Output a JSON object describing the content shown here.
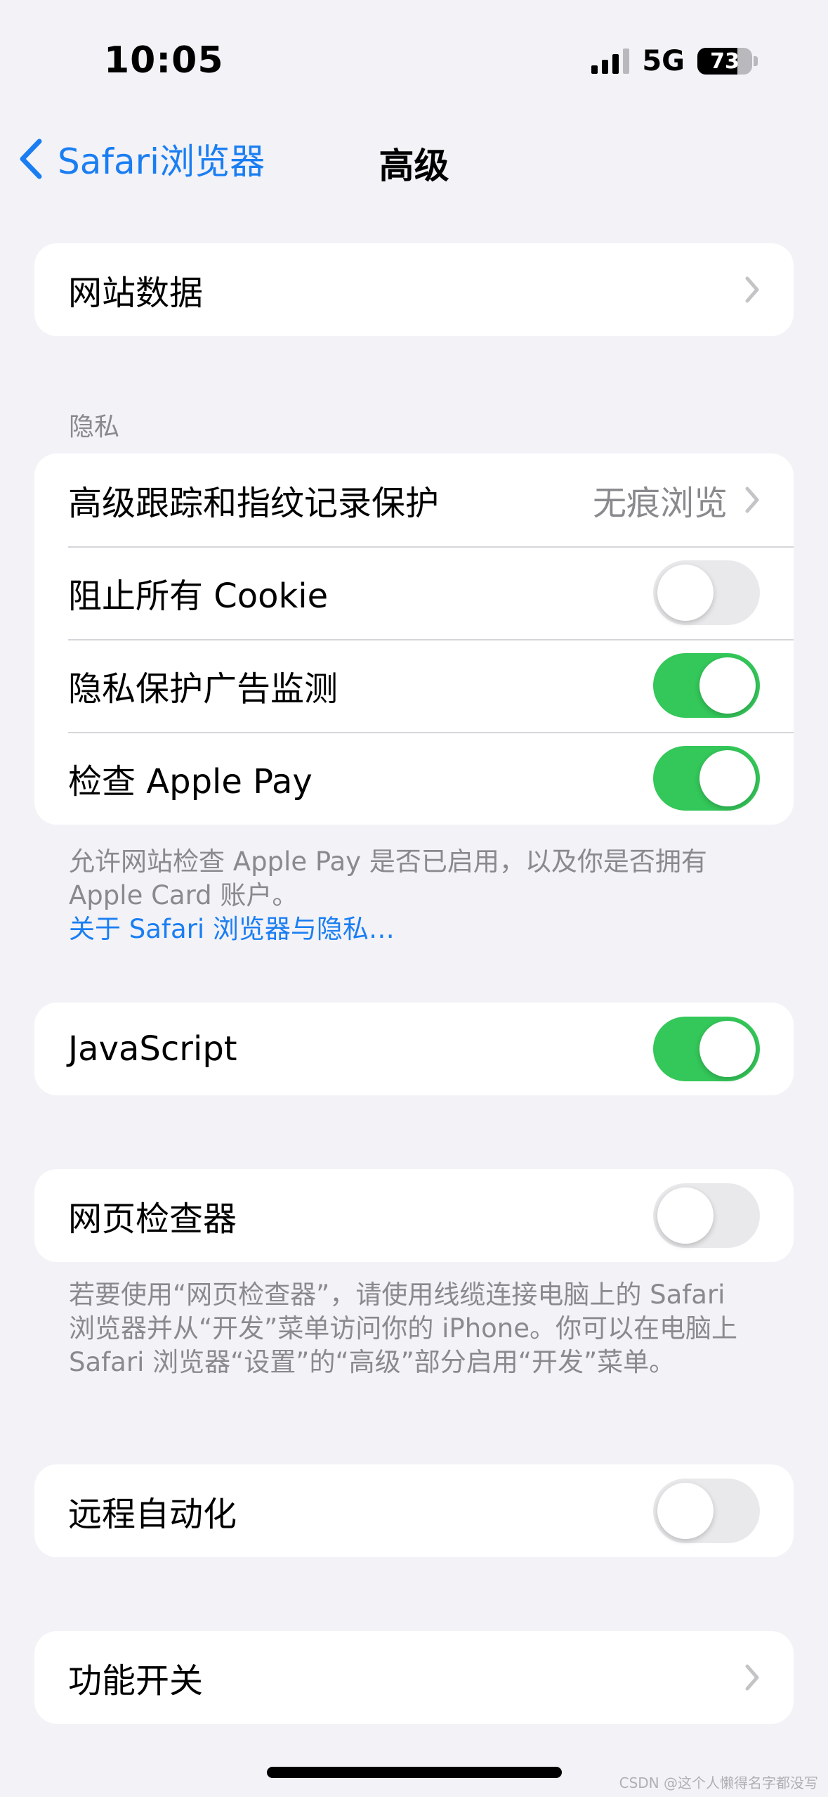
{
  "status_bar": {
    "time": "10:05",
    "network": "5G",
    "battery": "73",
    "battery_level": 0.73
  },
  "nav": {
    "back_label": "Safari浏览器",
    "title": "高级"
  },
  "groups": {
    "website_data": {
      "label": "网站数据"
    },
    "privacy": {
      "header": "隐私",
      "rows": [
        {
          "label": "高级跟踪和指纹记录保护",
          "value": "无痕浏览"
        },
        {
          "label": "阻止所有 Cookie",
          "on": false
        },
        {
          "label": "隐私保护广告监测",
          "on": true
        },
        {
          "label": "检查 Apple Pay",
          "on": true
        }
      ],
      "footer_text": "允许网站检查 Apple Pay 是否已启用，以及你是否拥有 Apple Card 账户。",
      "footer_link": "关于 Safari 浏览器与隐私…"
    },
    "javascript": {
      "label": "JavaScript",
      "on": true
    },
    "web_inspector": {
      "label": "网页检查器",
      "on": false,
      "footer_text": "若要使用“网页检查器”，请使用线缆连接电脑上的 Safari 浏览器并从“开发”菜单访问你的 iPhone。你可以在电脑上 Safari 浏览器“设置”的“高级”部分启用“开发”菜单。"
    },
    "remote_automation": {
      "label": "远程自动化",
      "on": false
    },
    "feature_flags": {
      "label": "功能开关"
    }
  },
  "watermark": "CSDN @这个人懒得名字都没写",
  "colors": {
    "accent": "#1a7ef2",
    "toggle_on": "#34c759",
    "background": "#f2f2f7"
  }
}
